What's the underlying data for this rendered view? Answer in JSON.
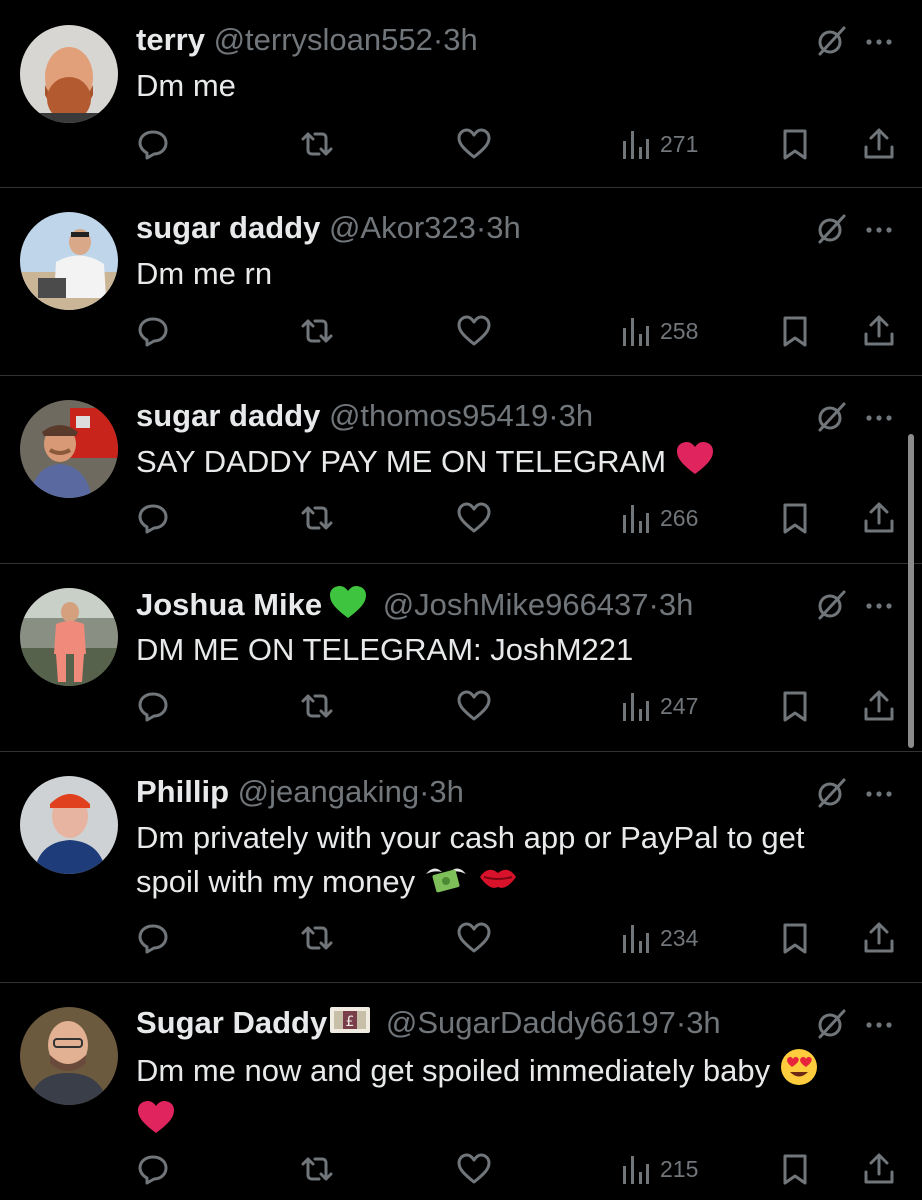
{
  "tweets": [
    {
      "name": "terry",
      "handle": "@terrysloan552",
      "dot": "·",
      "time": "3h",
      "text": "Dm me",
      "text2": "",
      "views": "271"
    },
    {
      "name": "sugar daddy",
      "handle": "@Akor323",
      "dot": "·",
      "time": "3h",
      "text": "Dm me rn",
      "text2": "",
      "views": "258"
    },
    {
      "name": "sugar daddy",
      "handle": "@thomos95419",
      "dot": "·",
      "time": "3h",
      "text": "SAY DADDY PAY ME ON TELEGRAM",
      "text2": "",
      "views": "266",
      "emoji": "red-heart"
    },
    {
      "name": "Joshua Mike",
      "handle": "@JoshMike966437",
      "dot": "·",
      "time": "3h",
      "text": "DM ME ON TELEGRAM: JoshM221",
      "text2": "",
      "views": "247",
      "badge": "green-heart"
    },
    {
      "name": "Phillip",
      "handle": "@jeangaking",
      "dot": "·",
      "time": "3h",
      "text": "Dm privately with your cash app or PayPal to get",
      "text2": "spoil with my money",
      "views": "234",
      "emoji": "money-with-wings, kiss-mark"
    },
    {
      "name": "Sugar Daddy",
      "handle": "@SugarDaddy66197",
      "dot": "·",
      "time": "3h",
      "text": "Dm me now and get spoiled immediately baby",
      "text2": "",
      "views": "215",
      "badge": "pound-banknote",
      "emoji": "heart-eyes, red-heart"
    }
  ],
  "colors": {
    "background": "#000000",
    "text": "#e7e9ea",
    "muted": "#71767b",
    "divider": "#2f3336",
    "heart_red": "#e0245e",
    "green_heart": "#3fc43f"
  },
  "icons": {
    "reply": "reply-icon",
    "retweet": "retweet-icon",
    "like": "like-icon",
    "views": "views-icon",
    "bookmark": "bookmark-icon",
    "share": "share-icon",
    "grok": "grok-icon",
    "more": "more-icon"
  }
}
